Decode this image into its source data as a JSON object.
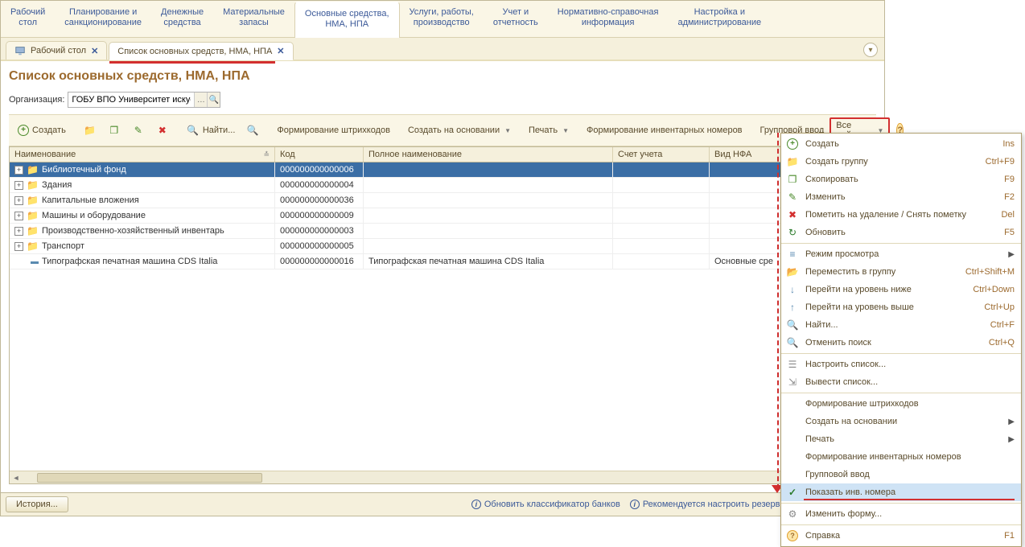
{
  "nav": {
    "items": [
      "Рабочий\nстол",
      "Планирование и\nсанкционирование",
      "Денежные\nсредства",
      "Материальные\nзапасы",
      "Основные средства,\nНМА, НПА",
      "Услуги, работы,\nпроизводство",
      "Учет и\nотчетность",
      "Нормативно-справочная\nинформация",
      "Настройка и\nадминистрирование"
    ],
    "active_index": 4
  },
  "tabs": {
    "items": [
      {
        "label": "Рабочий стол",
        "closable": true
      },
      {
        "label": "Список основных средств, НМА, НПА",
        "closable": true
      }
    ],
    "active_index": 1
  },
  "page": {
    "title": "Список основных средств, НМА, НПА",
    "org_label": "Организация:",
    "org_value": "ГОБУ ВПО Университет искусст"
  },
  "toolbar": {
    "create": "Создать",
    "find": "Найти...",
    "barcodes": "Формирование штрихкодов",
    "create_based": "Создать на основании",
    "print": "Печать",
    "inv_numbers": "Формирование инвентарных номеров",
    "group_input": "Групповой ввод",
    "all_actions": "Все действия"
  },
  "grid": {
    "columns": {
      "name": "Наименование",
      "code": "Код",
      "full": "Полное наименование",
      "acct": "Счет учета",
      "nfa": "Вид НФА"
    },
    "rows": [
      {
        "type": "folder",
        "name": "Библиотечный фонд",
        "code": "000000000000006",
        "selected": true
      },
      {
        "type": "folder",
        "name": "Здания",
        "code": "000000000000004"
      },
      {
        "type": "folder",
        "name": "Капитальные вложения",
        "code": "000000000000036"
      },
      {
        "type": "folder",
        "name": "Машины и оборудование",
        "code": "000000000000009"
      },
      {
        "type": "folder",
        "name": "Производственно-хозяйственный инвентарь",
        "code": "000000000000003"
      },
      {
        "type": "folder",
        "name": "Транспорт",
        "code": "000000000000005"
      },
      {
        "type": "item",
        "name": "Типографская печатная машина CDS Italia",
        "code": "000000000000016",
        "full": "Типографская печатная машина CDS Italia",
        "nfa": "Основные сре"
      }
    ]
  },
  "menu": {
    "items": [
      {
        "icon": "plus",
        "label": "Создать",
        "shortcut": "Ins"
      },
      {
        "icon": "folder-plus",
        "label": "Создать группу",
        "shortcut": "Ctrl+F9"
      },
      {
        "icon": "copy",
        "label": "Скопировать",
        "shortcut": "F9"
      },
      {
        "icon": "edit",
        "label": "Изменить",
        "shortcut": "F2"
      },
      {
        "icon": "delete",
        "label": "Пометить на удаление / Снять пометку",
        "shortcut": "Del"
      },
      {
        "icon": "refresh",
        "label": "Обновить",
        "shortcut": "F5"
      },
      {
        "icon": "view",
        "label": "Режим просмотра",
        "submenu": true
      },
      {
        "icon": "move",
        "label": "Переместить в группу",
        "shortcut": "Ctrl+Shift+M"
      },
      {
        "icon": "down",
        "label": "Перейти на уровень ниже",
        "shortcut": "Ctrl+Down"
      },
      {
        "icon": "up",
        "label": "Перейти на уровень выше",
        "shortcut": "Ctrl+Up"
      },
      {
        "icon": "search",
        "label": "Найти...",
        "shortcut": "Ctrl+F"
      },
      {
        "icon": "search-cancel",
        "label": "Отменить поиск",
        "shortcut": "Ctrl+Q"
      },
      {
        "icon": "settings",
        "label": "Настроить список..."
      },
      {
        "icon": "export",
        "label": "Вывести список..."
      },
      {
        "icon": "",
        "label": "Формирование штрихкодов"
      },
      {
        "icon": "",
        "label": "Создать на основании",
        "submenu": true
      },
      {
        "icon": "",
        "label": "Печать",
        "submenu": true
      },
      {
        "icon": "",
        "label": "Формирование инвентарных номеров"
      },
      {
        "icon": "",
        "label": "Групповой ввод"
      },
      {
        "icon": "check",
        "label": "Показать инв. номера",
        "highlight": true,
        "redline": true
      },
      {
        "icon": "gear",
        "label": "Изменить форму..."
      },
      {
        "icon": "help",
        "label": "Справка",
        "shortcut": "F1"
      }
    ]
  },
  "status": {
    "history": "История...",
    "link1": "Обновить классификатор банков",
    "link2": "Рекомендуется настроить резервное копирование инфор"
  }
}
